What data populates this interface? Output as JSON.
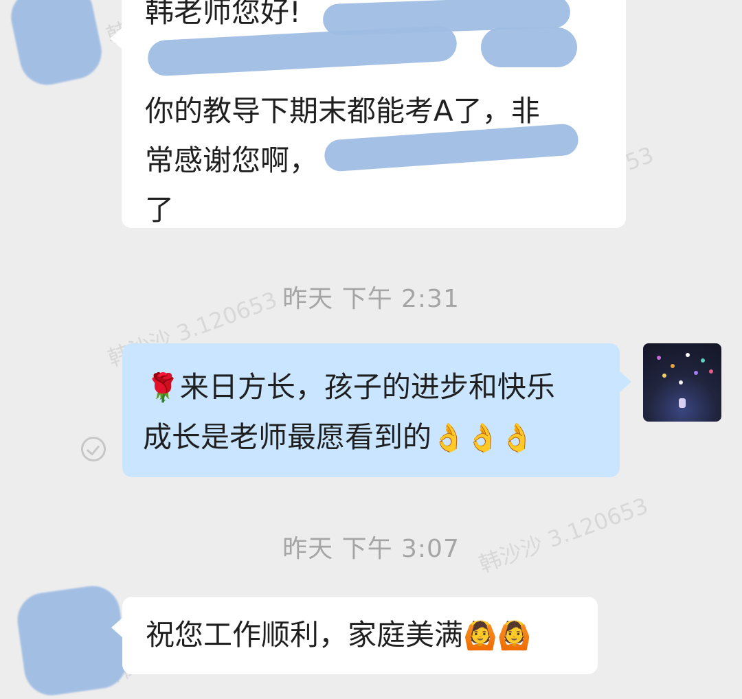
{
  "watermark": {
    "text_full": "韩沙沙 3.120653",
    "text_partial_1": "韩",
    "text_partial_2": "53"
  },
  "messages": [
    {
      "id": "msg-1",
      "direction": "in",
      "lines": [
        "韩老师您好!",
        "",
        "你的教导下期末都能考A了，非",
        "常感谢您啊，",
        "了"
      ]
    },
    {
      "id": "msg-2",
      "direction": "out",
      "lines": [
        "来日方长，孩子的进步和快乐",
        "成长是老师最愿看到的"
      ],
      "rose": "🌹",
      "hands": "👌👌👌"
    },
    {
      "id": "msg-3",
      "direction": "in",
      "lines": [
        "祝您工作顺利，家庭美满"
      ],
      "emoji": "🙆🙆"
    }
  ],
  "timestamps": [
    {
      "label": "昨天  下午 2:31"
    },
    {
      "label": "昨天  下午 3:07"
    }
  ],
  "colors": {
    "background": "#ededed",
    "incoming_bubble": "#ffffff",
    "outgoing_bubble": "#c9e5ff",
    "redaction": "#9fbde3"
  },
  "icons": {
    "read_status": "check-circle-icon",
    "my_avatar": "night-sky-avatar"
  }
}
